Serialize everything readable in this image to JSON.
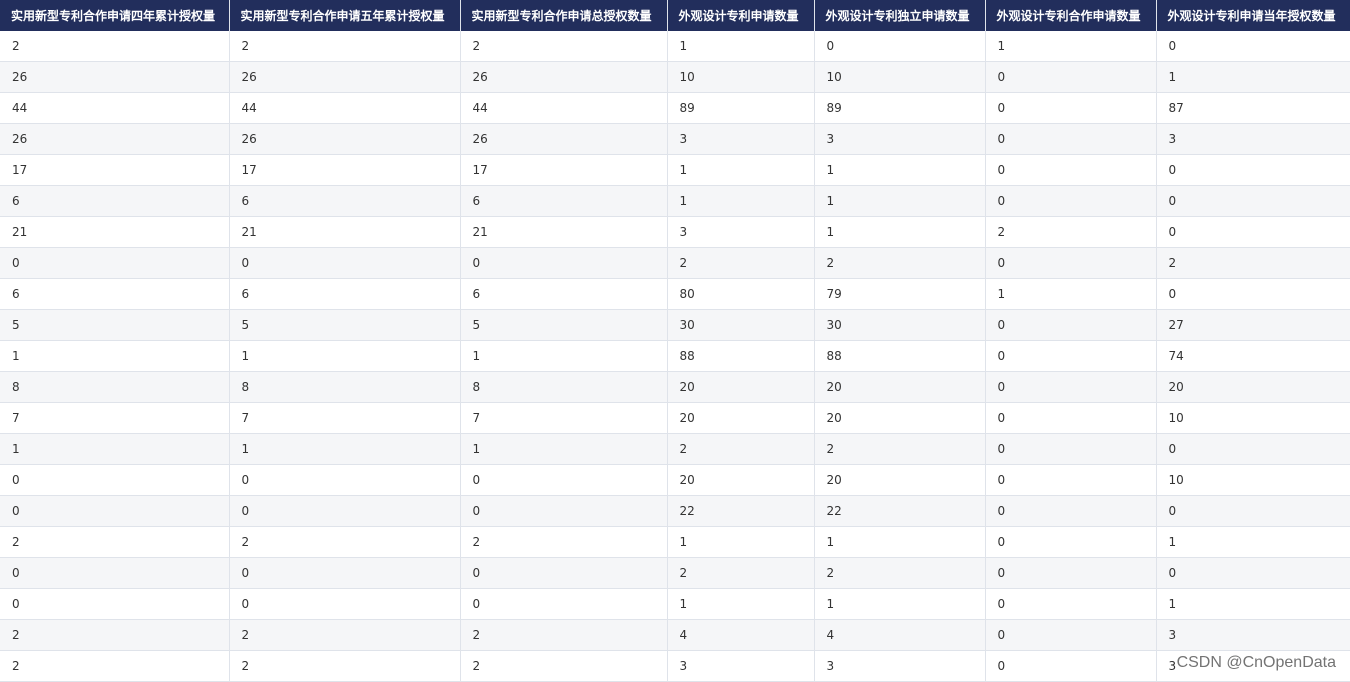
{
  "headers": [
    "实用新型专利合作申请四年累计授权量",
    "实用新型专利合作申请五年累计授权量",
    "实用新型专利合作申请总授权数量",
    "外观设计专利申请数量",
    "外观设计专利独立申请数量",
    "外观设计专利合作申请数量",
    "外观设计专利申请当年授权数量"
  ],
  "rows": [
    [
      "2",
      "2",
      "2",
      "1",
      "0",
      "1",
      "0"
    ],
    [
      "26",
      "26",
      "26",
      "10",
      "10",
      "0",
      "1"
    ],
    [
      "44",
      "44",
      "44",
      "89",
      "89",
      "0",
      "87"
    ],
    [
      "26",
      "26",
      "26",
      "3",
      "3",
      "0",
      "3"
    ],
    [
      "17",
      "17",
      "17",
      "1",
      "1",
      "0",
      "0"
    ],
    [
      "6",
      "6",
      "6",
      "1",
      "1",
      "0",
      "0"
    ],
    [
      "21",
      "21",
      "21",
      "3",
      "1",
      "2",
      "0"
    ],
    [
      "0",
      "0",
      "0",
      "2",
      "2",
      "0",
      "2"
    ],
    [
      "6",
      "6",
      "6",
      "80",
      "79",
      "1",
      "0"
    ],
    [
      "5",
      "5",
      "5",
      "30",
      "30",
      "0",
      "27"
    ],
    [
      "1",
      "1",
      "1",
      "88",
      "88",
      "0",
      "74"
    ],
    [
      "8",
      "8",
      "8",
      "20",
      "20",
      "0",
      "20"
    ],
    [
      "7",
      "7",
      "7",
      "20",
      "20",
      "0",
      "10"
    ],
    [
      "1",
      "1",
      "1",
      "2",
      "2",
      "0",
      "0"
    ],
    [
      "0",
      "0",
      "0",
      "20",
      "20",
      "0",
      "10"
    ],
    [
      "0",
      "0",
      "0",
      "22",
      "22",
      "0",
      "0"
    ],
    [
      "2",
      "2",
      "2",
      "1",
      "1",
      "0",
      "1"
    ],
    [
      "0",
      "0",
      "0",
      "2",
      "2",
      "0",
      "0"
    ],
    [
      "0",
      "0",
      "0",
      "1",
      "1",
      "0",
      "1"
    ],
    [
      "2",
      "2",
      "2",
      "4",
      "4",
      "0",
      "3"
    ],
    [
      "2",
      "2",
      "2",
      "3",
      "3",
      "0",
      "3"
    ]
  ],
  "watermark": "CSDN @CnOpenData"
}
